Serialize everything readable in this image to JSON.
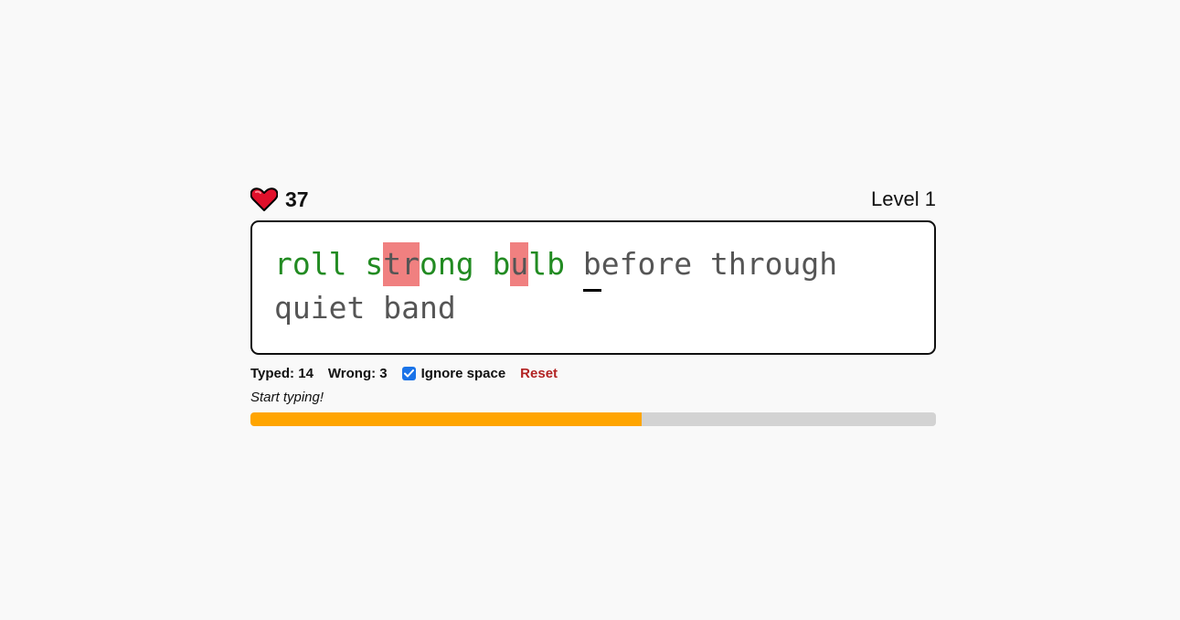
{
  "header": {
    "lives_icon": "heart-icon",
    "lives": "37",
    "level": "Level 1"
  },
  "text": {
    "words": [
      {
        "chars": [
          {
            "c": "r",
            "s": "correct"
          },
          {
            "c": "o",
            "s": "correct"
          },
          {
            "c": "l",
            "s": "correct"
          },
          {
            "c": "l",
            "s": "correct"
          }
        ]
      },
      {
        "chars": [
          {
            "c": "s",
            "s": "correct"
          },
          {
            "c": "t",
            "s": "wrong"
          },
          {
            "c": "r",
            "s": "wrong"
          },
          {
            "c": "o",
            "s": "correct"
          },
          {
            "c": "n",
            "s": "correct"
          },
          {
            "c": "g",
            "s": "correct"
          }
        ]
      },
      {
        "chars": [
          {
            "c": "b",
            "s": "correct"
          },
          {
            "c": "u",
            "s": "wrong"
          },
          {
            "c": "l",
            "s": "correct"
          },
          {
            "c": "b",
            "s": "correct"
          }
        ]
      },
      {
        "chars": [
          {
            "c": "b",
            "s": "cursor"
          },
          {
            "c": "e",
            "s": "pending"
          },
          {
            "c": "f",
            "s": "pending"
          },
          {
            "c": "o",
            "s": "pending"
          },
          {
            "c": "r",
            "s": "pending"
          },
          {
            "c": "e",
            "s": "pending"
          }
        ]
      },
      {
        "chars": [
          {
            "c": "t",
            "s": "pending"
          },
          {
            "c": "h",
            "s": "pending"
          },
          {
            "c": "r",
            "s": "pending"
          },
          {
            "c": "o",
            "s": "pending"
          },
          {
            "c": "u",
            "s": "pending"
          },
          {
            "c": "g",
            "s": "pending"
          },
          {
            "c": "h",
            "s": "pending"
          }
        ]
      },
      {
        "chars": [
          {
            "c": "q",
            "s": "pending"
          },
          {
            "c": "u",
            "s": "pending"
          },
          {
            "c": "i",
            "s": "pending"
          },
          {
            "c": "e",
            "s": "pending"
          },
          {
            "c": "t",
            "s": "pending"
          }
        ]
      },
      {
        "chars": [
          {
            "c": "b",
            "s": "pending"
          },
          {
            "c": "a",
            "s": "pending"
          },
          {
            "c": "n",
            "s": "pending"
          },
          {
            "c": "d",
            "s": "pending"
          }
        ]
      }
    ]
  },
  "stats": {
    "typed": "Typed: 14",
    "wrong": "Wrong: 3",
    "ignore_space_label": "Ignore space",
    "ignore_space_checked": true,
    "reset_label": "Reset"
  },
  "status": "Start typing!",
  "progress": {
    "fraction": 0.57
  },
  "colors": {
    "correct": "#228b22",
    "wrong_bg": "#f08080",
    "pending": "#555555",
    "progress_fill": "#ffa500",
    "progress_track": "#d3d3d3",
    "checkbox": "#1a73e8",
    "reset": "#b22222"
  }
}
